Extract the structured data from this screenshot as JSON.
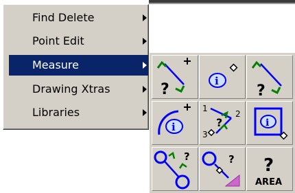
{
  "menu": {
    "items": [
      {
        "label": "Find Delete",
        "icon": "chevron-right-icon"
      },
      {
        "label": "Point Edit",
        "icon": "chevron-right-icon"
      },
      {
        "label": "Measure",
        "icon": "chevron-right-icon",
        "selected": true
      },
      {
        "label": "Drawing Xtras",
        "icon": "chevron-right-icon"
      },
      {
        "label": "Libraries",
        "icon": "chevron-right-icon"
      }
    ]
  },
  "palette": {
    "tools": [
      {
        "icon": "measure-distance-add-icon",
        "text": "?"
      },
      {
        "icon": "point-info-icon"
      },
      {
        "icon": "measure-distance-icon",
        "text": "?"
      },
      {
        "icon": "radius-info-add-icon"
      },
      {
        "icon": "measure-angle-icon",
        "text": "?",
        "num1": "1",
        "num2": "2",
        "num3": "3"
      },
      {
        "icon": "object-info-icon"
      },
      {
        "icon": "measure-circle-distance-icon",
        "text": "?"
      },
      {
        "icon": "measure-circle-to-area-icon",
        "text": "?"
      },
      {
        "icon": "measure-area-icon",
        "text": "?",
        "caption": "AREA"
      }
    ]
  },
  "colors": {
    "menu_bg": "#d4d0c8",
    "selection": "#0a246a",
    "icon_blue": "#0000ff",
    "icon_green": "#008000",
    "icon_magenta": "#cc66cc"
  }
}
